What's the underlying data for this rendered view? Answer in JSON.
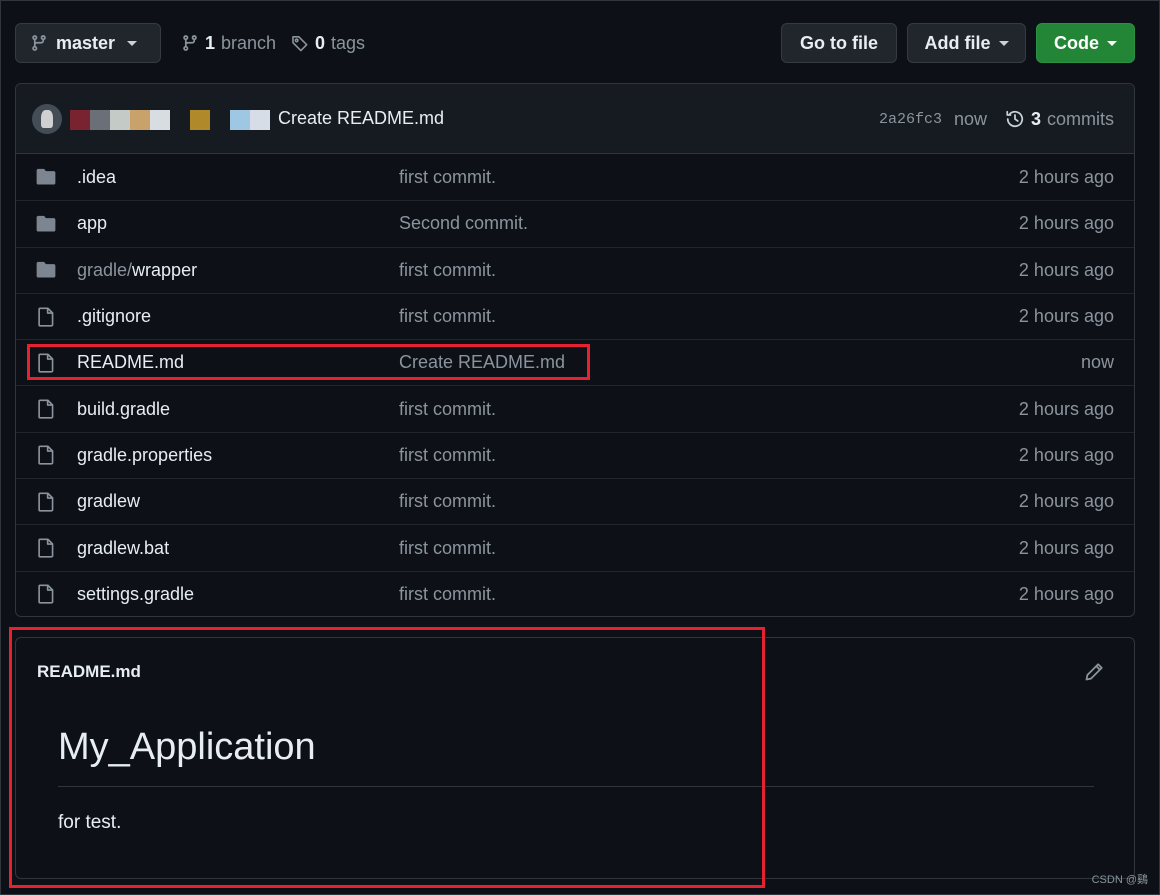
{
  "toolbar": {
    "branch_name": "master",
    "branch_count": "1",
    "branch_label": "branch",
    "tag_count": "0",
    "tag_label": "tags",
    "goto_file": "Go to file",
    "add_file": "Add file",
    "code": "Code"
  },
  "latest_commit": {
    "message": "Create README.md",
    "sha": "2a26fc3",
    "time": "now",
    "commit_count": "3",
    "commits_label": "commits"
  },
  "files": [
    {
      "type": "folder",
      "name": ".idea",
      "name_prefix": "",
      "message": "first commit.",
      "age": "2 hours ago"
    },
    {
      "type": "folder",
      "name": "app",
      "name_prefix": "",
      "message": "Second commit.",
      "age": "2 hours ago"
    },
    {
      "type": "folder",
      "name": "wrapper",
      "name_prefix": "gradle/",
      "message": "first commit.",
      "age": "2 hours ago"
    },
    {
      "type": "file",
      "name": ".gitignore",
      "name_prefix": "",
      "message": "first commit.",
      "age": "2 hours ago"
    },
    {
      "type": "file",
      "name": "README.md",
      "name_prefix": "",
      "message": "Create README.md",
      "age": "now"
    },
    {
      "type": "file",
      "name": "build.gradle",
      "name_prefix": "",
      "message": "first commit.",
      "age": "2 hours ago"
    },
    {
      "type": "file",
      "name": "gradle.properties",
      "name_prefix": "",
      "message": "first commit.",
      "age": "2 hours ago"
    },
    {
      "type": "file",
      "name": "gradlew",
      "name_prefix": "",
      "message": "first commit.",
      "age": "2 hours ago"
    },
    {
      "type": "file",
      "name": "gradlew.bat",
      "name_prefix": "",
      "message": "first commit.",
      "age": "2 hours ago"
    },
    {
      "type": "file",
      "name": "settings.gradle",
      "name_prefix": "",
      "message": "first commit.",
      "age": "2 hours ago"
    }
  ],
  "readme": {
    "filename": "README.md",
    "heading": "My_Application",
    "body": "for test."
  },
  "watermark": "CSDN @鷄",
  "colors": {
    "background": "#0d1117",
    "header_bg": "#161b22",
    "border": "#30363d",
    "code_button": "#238636",
    "annotation": "#e5222d",
    "folder_icon": "#7d8590"
  }
}
